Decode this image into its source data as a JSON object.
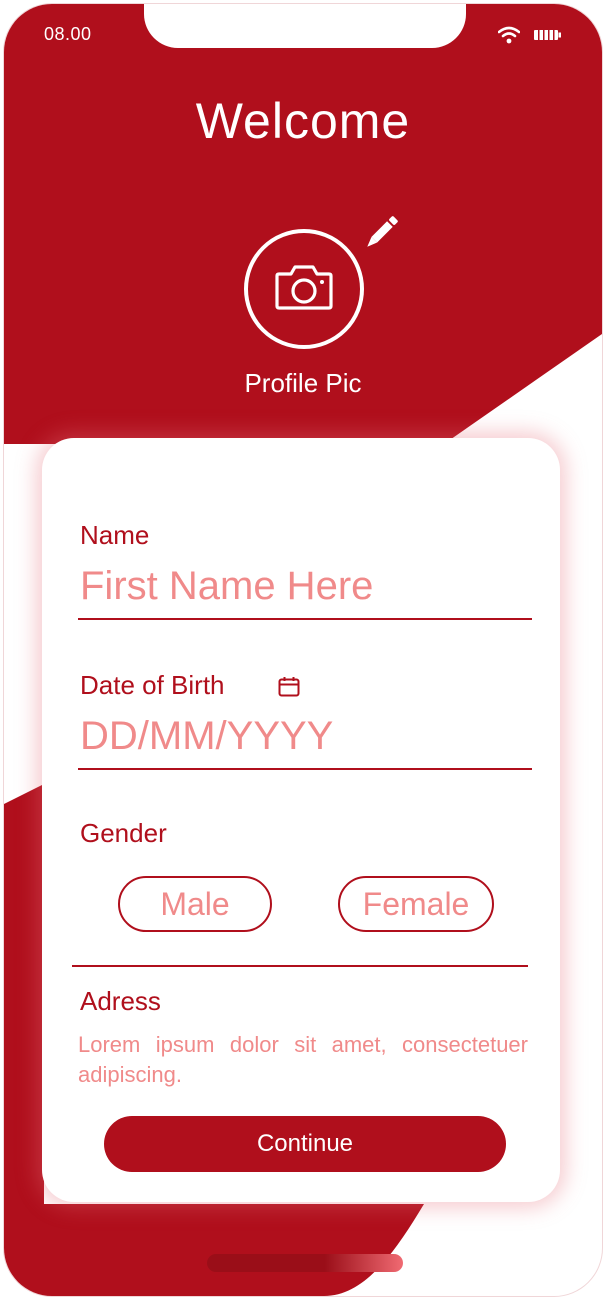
{
  "status_bar": {
    "time": "08.00",
    "wifi_icon": "wifi-icon",
    "battery_icon": "battery-icon"
  },
  "header": {
    "title": "Welcome",
    "camera_icon": "camera-icon",
    "edit_icon": "pencil-icon",
    "profile_label": "Profile Pic"
  },
  "form": {
    "name": {
      "label": "Name",
      "placeholder": "First Name Here",
      "value": ""
    },
    "dob": {
      "label": "Date of Birth",
      "icon": "calendar-icon",
      "placeholder": "DD/MM/YYYY",
      "value": ""
    },
    "gender": {
      "label": "Gender",
      "options": [
        "Male",
        "Female"
      ]
    },
    "address": {
      "label": "Adress",
      "text": "Lorem ipsum dolor sit amet, consectetuer adipiscing."
    },
    "continue_label": "Continue"
  },
  "colors": {
    "primary": "#b00f1c",
    "placeholder": "#f08a8a",
    "background": "#ffffff"
  }
}
